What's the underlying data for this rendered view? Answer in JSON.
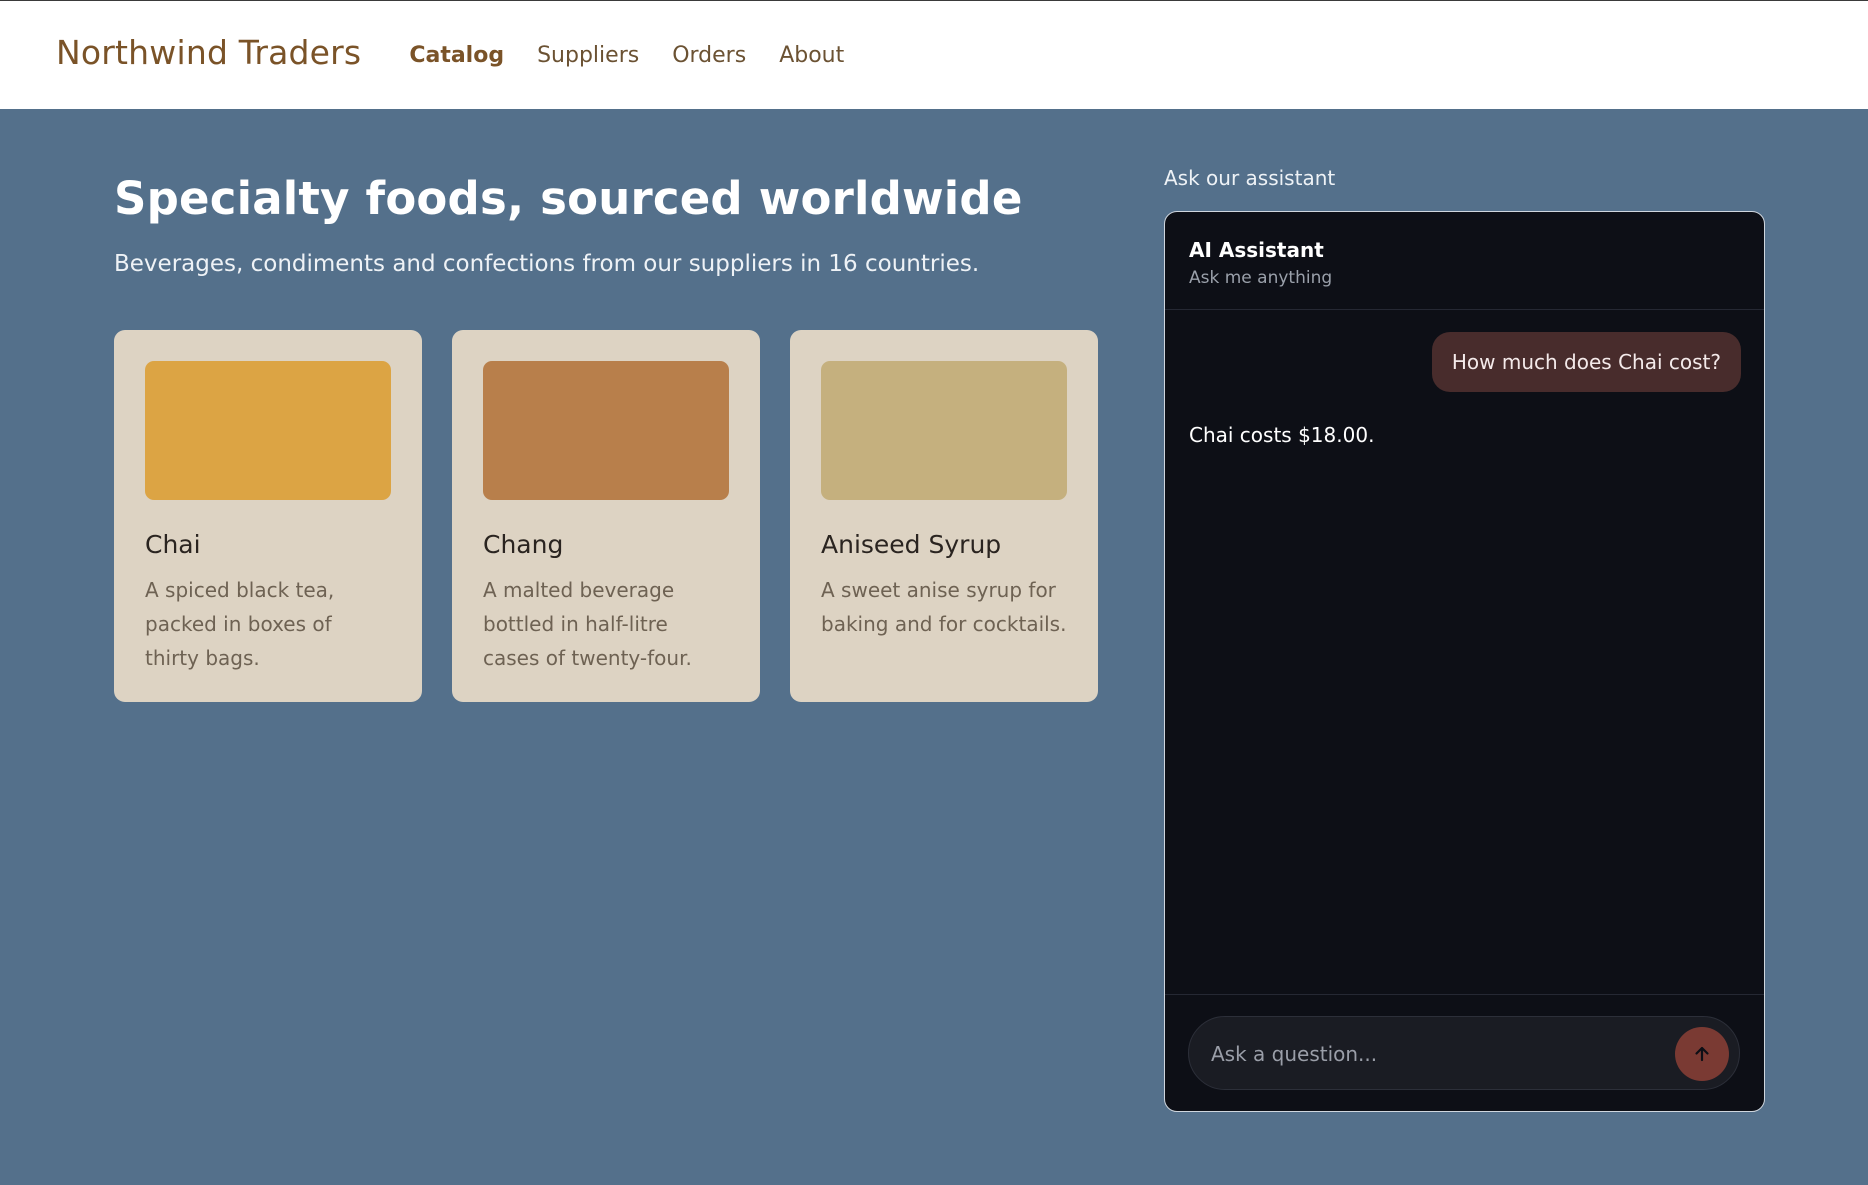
{
  "header": {
    "brand": "Northwind Traders",
    "nav": [
      {
        "label": "Catalog",
        "active": true
      },
      {
        "label": "Suppliers",
        "active": false
      },
      {
        "label": "Orders",
        "active": false
      },
      {
        "label": "About",
        "active": false
      }
    ]
  },
  "hero": {
    "title": "Specialty foods, sourced worldwide",
    "subtitle": "Beverages, condiments and confections from our suppliers in 16 countries."
  },
  "products": [
    {
      "name": "Chai",
      "description": "A spiced black tea, packed in boxes of thirty bags.",
      "color": "#dca444"
    },
    {
      "name": "Chang",
      "description": "A malted beverage bottled in half-litre cases of twenty-four.",
      "color": "#b87f4b"
    },
    {
      "name": "Aniseed Syrup",
      "description": "A sweet anise syrup for baking and for cocktails.",
      "color": "#c5b07e"
    }
  ],
  "assistant": {
    "section_label": "Ask our assistant",
    "title": "AI Assistant",
    "subtitle": "Ask me anything",
    "messages": {
      "user": "How much does Chai cost?",
      "bot": "Chai costs $18.00."
    },
    "input_placeholder": "Ask a question...",
    "send_icon": "arrow-up-icon"
  },
  "colors": {
    "page_bg": "#54708b",
    "brand": "#7a5328",
    "card_bg": "#ddd3c3",
    "chat_bg": "#0d0f16",
    "user_bubble": "#482c2c",
    "send_button": "#7a3a33"
  }
}
